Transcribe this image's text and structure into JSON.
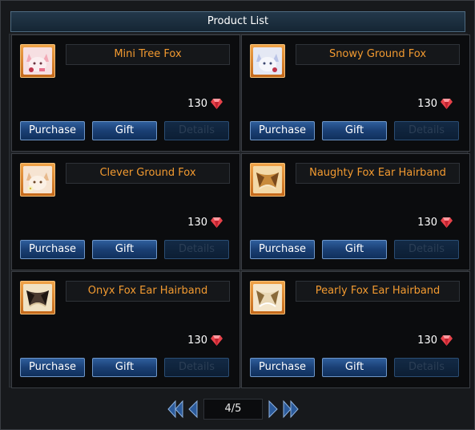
{
  "title": "Product List",
  "buttons": {
    "purchase": "Purchase",
    "gift": "Gift",
    "details": "Details"
  },
  "currency_icon": "ruby-gem-icon",
  "products": [
    {
      "name": "Mini Tree Fox",
      "price": "130",
      "icon": "mini-tree-fox-icon"
    },
    {
      "name": "Snowy Ground Fox",
      "price": "130",
      "icon": "snowy-ground-fox-icon"
    },
    {
      "name": "Clever Ground Fox",
      "price": "130",
      "icon": "clever-ground-fox-icon"
    },
    {
      "name": "Naughty Fox Ear Hairband",
      "price": "130",
      "icon": "naughty-fox-ear-hairband-icon"
    },
    {
      "name": "Onyx Fox Ear Hairband",
      "price": "130",
      "icon": "onyx-fox-ear-hairband-icon"
    },
    {
      "name": "Pearly Fox Ear Hairband",
      "price": "130",
      "icon": "pearly-fox-ear-hairband-icon"
    }
  ],
  "pagination": {
    "page_display": "4/5"
  },
  "colors": {
    "name_text": "#f29a30",
    "button_blue": "#1a3f74",
    "gem": "#e8424a"
  }
}
